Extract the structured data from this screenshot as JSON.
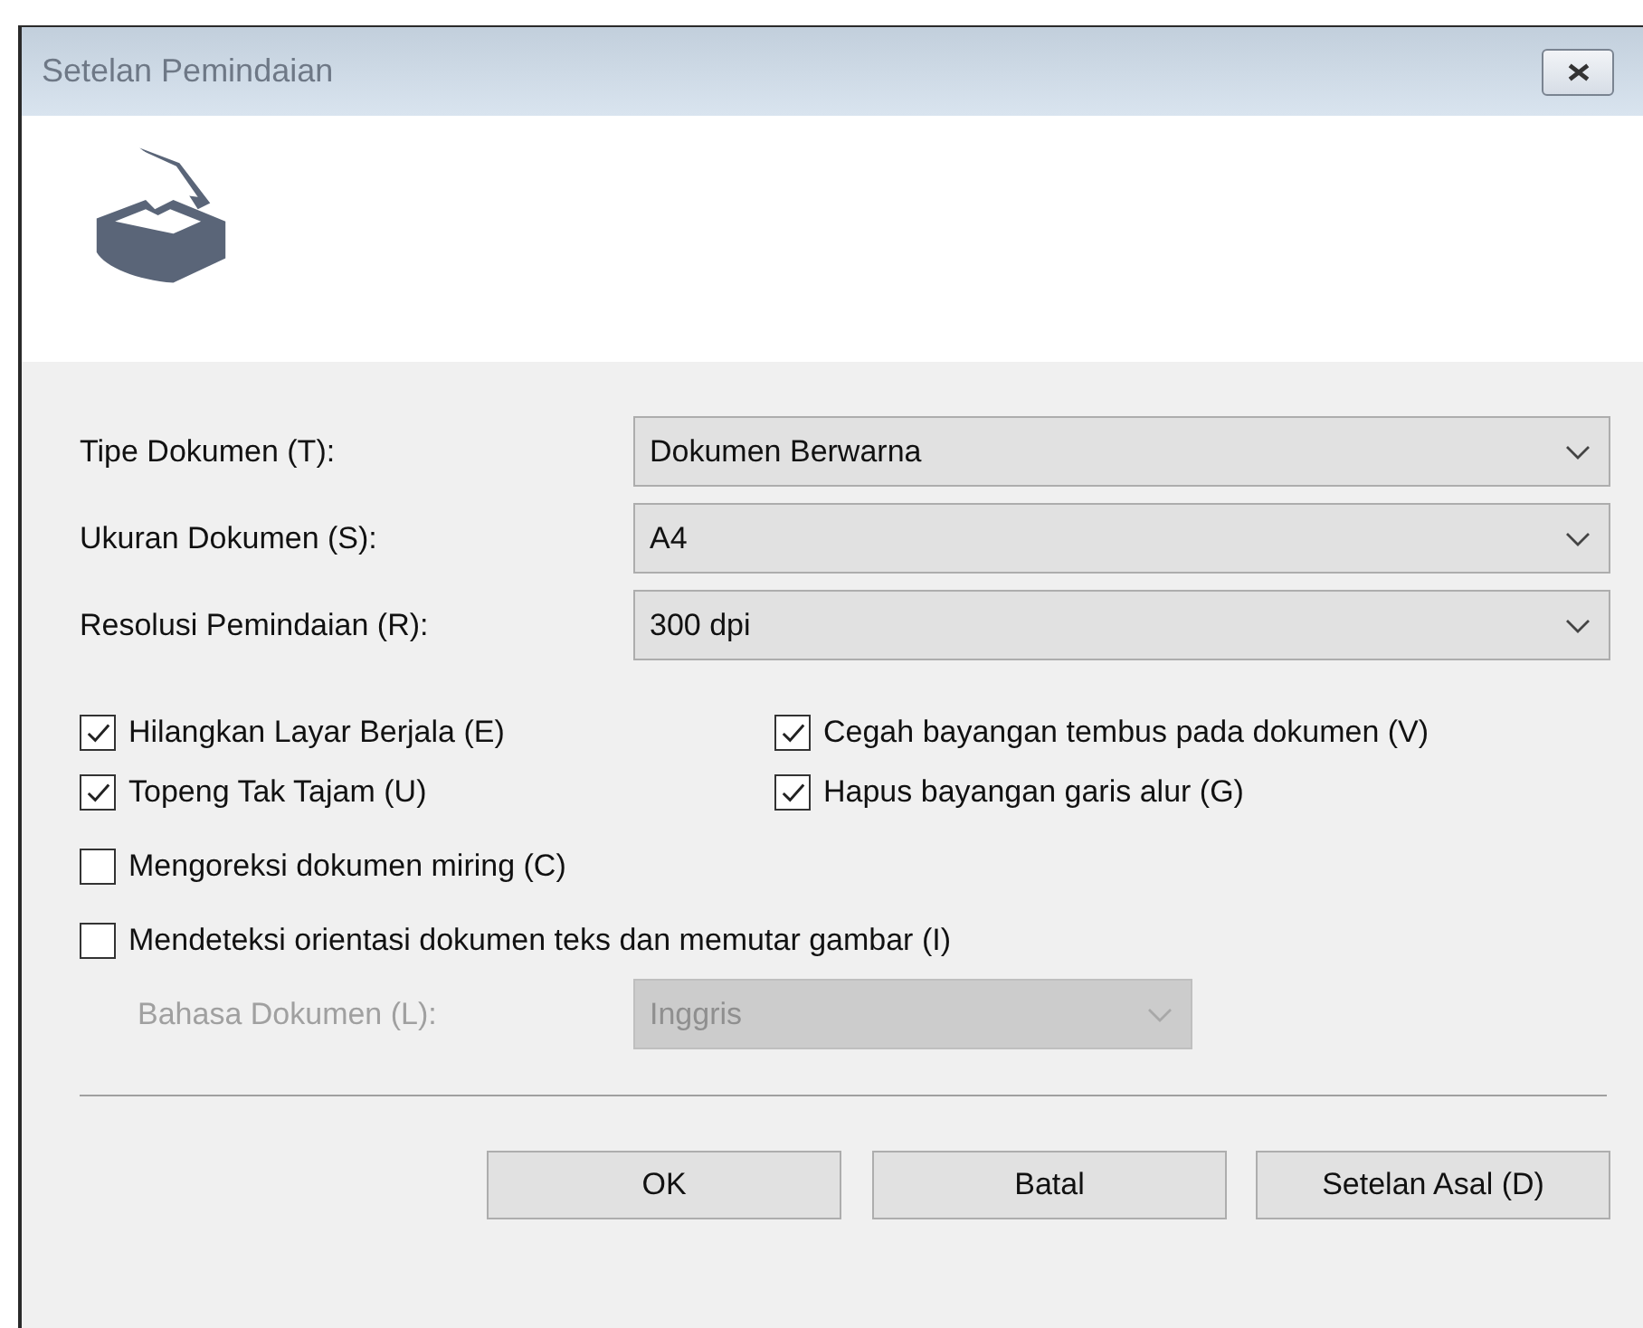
{
  "window": {
    "title": "Setelan Pemindaian"
  },
  "fields": [
    {
      "label": "Tipe Dokumen (T):",
      "value": "Dokumen Berwarna",
      "disabled": false
    },
    {
      "label": "Ukuran Dokumen (S):",
      "value": "A4",
      "disabled": false
    },
    {
      "label": "Resolusi Pemindaian (R):",
      "value": "300 dpi",
      "disabled": false
    }
  ],
  "option_pairs": [
    [
      {
        "label": "Hilangkan Layar Berjala (E)",
        "checked": true
      },
      {
        "label": "Cegah bayangan tembus pada dokumen (V)",
        "checked": true
      }
    ],
    [
      {
        "label": "Topeng Tak Tajam (U)",
        "checked": true
      },
      {
        "label": "Hapus bayangan garis alur (G)",
        "checked": true
      }
    ]
  ],
  "options": [
    {
      "label": "Mengoreksi dokumen miring (C)",
      "checked": false
    },
    {
      "label": "Mendeteksi orientasi dokumen teks dan memutar gambar (I)",
      "checked": false
    }
  ],
  "language": {
    "label": "Bahasa Dokumen (L):",
    "value": "Inggris",
    "disabled": true
  },
  "buttons": [
    "OK",
    "Batal",
    "Setelan Asal (D)"
  ]
}
